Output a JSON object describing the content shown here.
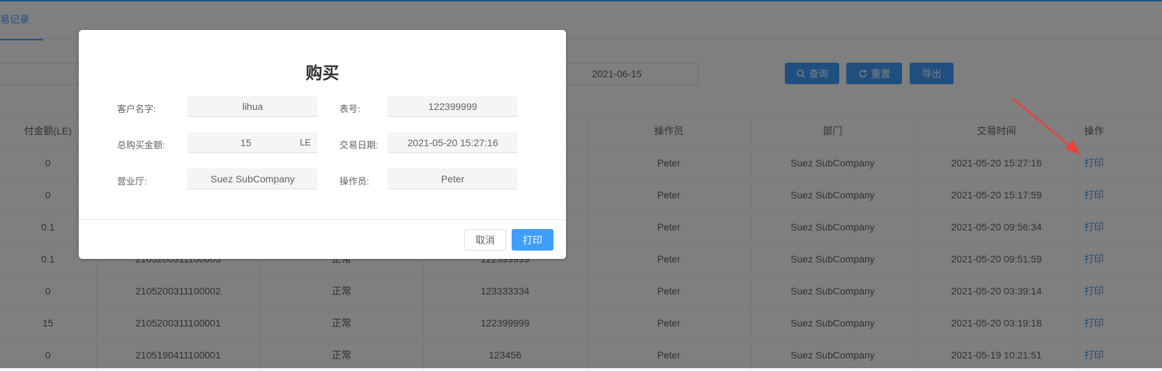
{
  "tabs": {
    "active_label": "易记录"
  },
  "filters": {
    "date_separator": "~",
    "date_end": "2021-06-15"
  },
  "buttons": {
    "query": "查询",
    "reset": "重置",
    "export": "导出"
  },
  "table": {
    "headers": [
      "付金额(LE)",
      "",
      "",
      "",
      "操作员",
      "部门",
      "交易时间",
      "操作"
    ],
    "rows": [
      {
        "amount": "0",
        "order": "",
        "status": "",
        "meter": "",
        "operator": "Peter",
        "dept": "Suez SubCompany",
        "time": "2021-05-20 15:27:16",
        "action": "打印"
      },
      {
        "amount": "0",
        "order": "",
        "status": "",
        "meter": "",
        "operator": "Peter",
        "dept": "Suez SubCompany",
        "time": "2021-05-20 15:17:59",
        "action": "打印"
      },
      {
        "amount": "0.1",
        "order": "",
        "status": "",
        "meter": "",
        "operator": "Peter",
        "dept": "Suez SubCompany",
        "time": "2021-05-20 09:56:34",
        "action": "打印"
      },
      {
        "amount": "0.1",
        "order": "2105200311100003",
        "status": "正常",
        "meter": "122399999",
        "operator": "Peter",
        "dept": "Suez SubCompany",
        "time": "2021-05-20 09:51:59",
        "action": "打印"
      },
      {
        "amount": "0",
        "order": "2105200311100002",
        "status": "正常",
        "meter": "123333334",
        "operator": "Peter",
        "dept": "Suez SubCompany",
        "time": "2021-05-20 03:39:14",
        "action": "打印"
      },
      {
        "amount": "15",
        "order": "2105200311100001",
        "status": "正常",
        "meter": "122399999",
        "operator": "Peter",
        "dept": "Suez SubCompany",
        "time": "2021-05-20 03:19:18",
        "action": "打印"
      },
      {
        "amount": "0",
        "order": "2105190411100001",
        "status": "正常",
        "meter": "123456",
        "operator": "Peter",
        "dept": "Suez SubCompany",
        "time": "2021-05-19 10:21:51",
        "action": "打印"
      }
    ]
  },
  "dialog": {
    "title": "购买",
    "customer_label": "客户名字:",
    "customer_value": "lihua",
    "meter_label": "表号:",
    "meter_value": "122399999",
    "total_label": "总购买金额:",
    "total_value": "15",
    "total_unit": "LE",
    "date_label": "交易日期:",
    "date_value": "2021-05-20 15:27:16",
    "hall_label": "营业厅:",
    "hall_value": "Suez SubCompany",
    "operator_label": "操作员:",
    "operator_value": "Peter",
    "cancel": "取消",
    "print": "打印"
  },
  "colors": {
    "accent": "#409eff",
    "annotation": "#e8413c"
  }
}
